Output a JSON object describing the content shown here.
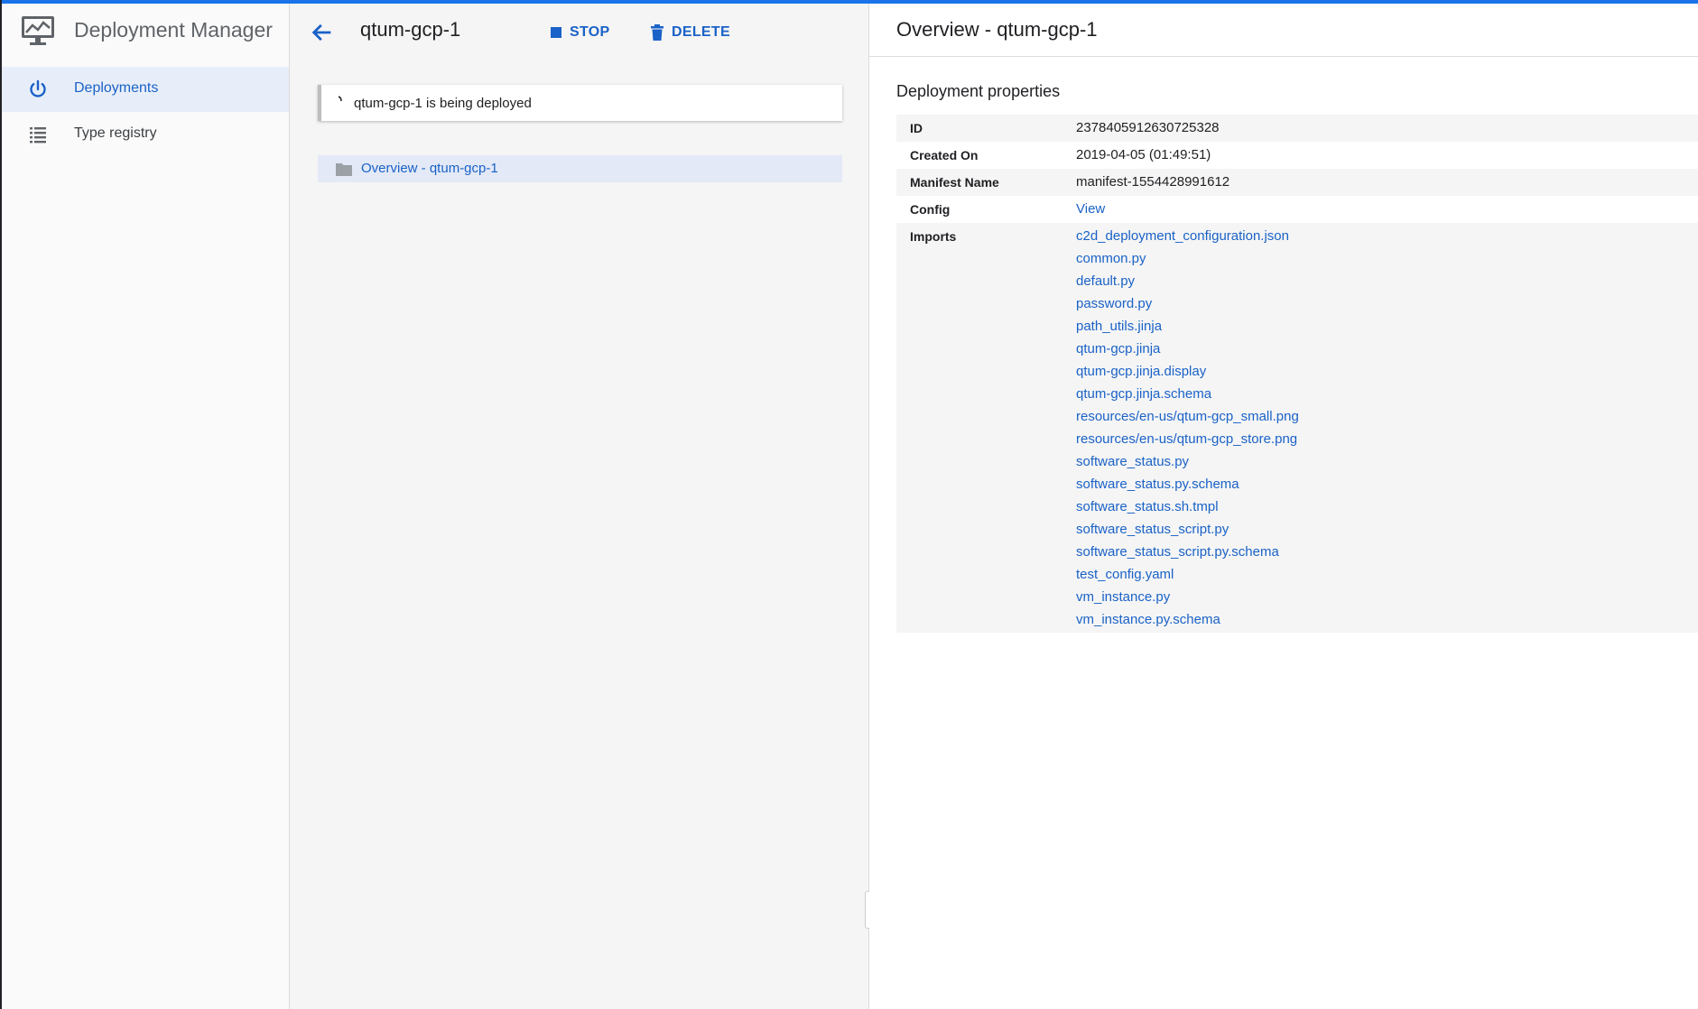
{
  "app": {
    "title": "Deployment Manager",
    "accent_color": "#1a73e8",
    "link_color": "#1a62c7"
  },
  "sidebar": {
    "items": [
      {
        "label": "Deployments",
        "icon": "power-icon",
        "active": true
      },
      {
        "label": "Type registry",
        "icon": "list-icon",
        "active": false
      }
    ]
  },
  "middle": {
    "deployment_name": "qtum-gcp-1",
    "stop_label": "STOP",
    "delete_label": "DELETE",
    "status_text": "qtum-gcp-1 is being deployed",
    "tree_item": "Overview - qtum-gcp-1"
  },
  "details": {
    "title": "Overview - qtum-gcp-1",
    "section_title": "Deployment properties",
    "properties": {
      "id_label": "ID",
      "id_value": "2378405912630725328",
      "created_label": "Created On",
      "created_value": "2019-04-05 (01:49:51)",
      "manifest_label": "Manifest Name",
      "manifest_value": "manifest-1554428991612",
      "config_label": "Config",
      "config_value": "View",
      "imports_label": "Imports"
    },
    "imports": [
      "c2d_deployment_configuration.json",
      "common.py",
      "default.py",
      "password.py",
      "path_utils.jinja",
      "qtum-gcp.jinja",
      "qtum-gcp.jinja.display",
      "qtum-gcp.jinja.schema",
      "resources/en-us/qtum-gcp_small.png",
      "resources/en-us/qtum-gcp_store.png",
      "software_status.py",
      "software_status.py.schema",
      "software_status.sh.tmpl",
      "software_status_script.py",
      "software_status_script.py.schema",
      "test_config.yaml",
      "vm_instance.py",
      "vm_instance.py.schema"
    ]
  }
}
